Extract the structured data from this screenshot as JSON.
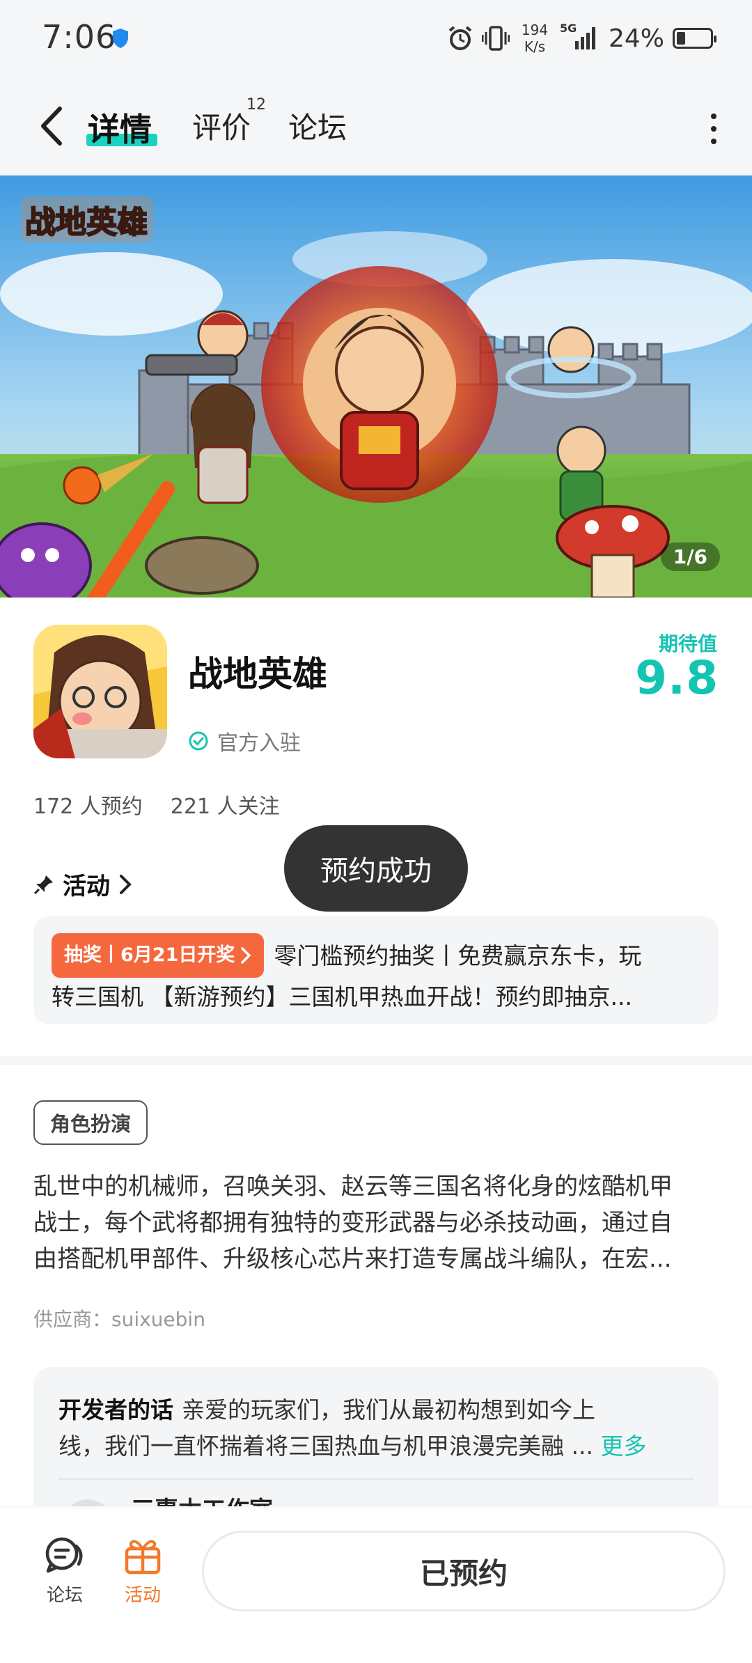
{
  "status_bar": {
    "time": "7:06",
    "net_speed_value": "194",
    "net_speed_unit": "K/s",
    "network": "5G",
    "battery": "24%"
  },
  "nav": {
    "tabs": [
      {
        "label": "详情",
        "active": true
      },
      {
        "label": "评价",
        "badge": "12"
      },
      {
        "label": "论坛"
      }
    ]
  },
  "banner": {
    "logo_text": "战地英雄",
    "counter": "1/6"
  },
  "app": {
    "name": "战地英雄",
    "official": "官方入驻",
    "expect_label": "期待值",
    "expect_value": "9.8",
    "stats": [
      "172 人预约",
      "221 人关注"
    ]
  },
  "activity": {
    "heading": "活动",
    "tag": "抽奖丨6月21日开奖",
    "line1": "零门槛预约抽奖丨免费赢京东卡，玩",
    "line2": "转三国机 【新游预约】三国机甲热血开战！预约即抽京..."
  },
  "toast": "预约成功",
  "genre_tag": "角色扮演",
  "description": [
    "乱世中的机械师，召唤关羽、赵云等三国名将化身的炫酷机甲",
    "战士，每个武将都拥有独特的变形武器与必杀技动画，通过自",
    "由搭配机甲部件、升级核心芯片来打造专属战斗编队，在宏..."
  ],
  "supplier": "供应商：suixuebin",
  "developer": {
    "title": "开发者的话",
    "line1": "亲爱的玩家们，我们从最初构想到如今上",
    "line2": "线，我们一直怀揣着将三国热血与机甲浪漫完美融 ...",
    "more": "更多",
    "studio": "三惠木工作室"
  },
  "bottom_bar": {
    "forum_label": "论坛",
    "activity_label": "活动",
    "reserve_button": "已预约"
  },
  "colors": {
    "accent": "#14c4b2",
    "orange": "#f2792b",
    "tag_orange": "#f5683d",
    "toast_bg": "#333333"
  }
}
